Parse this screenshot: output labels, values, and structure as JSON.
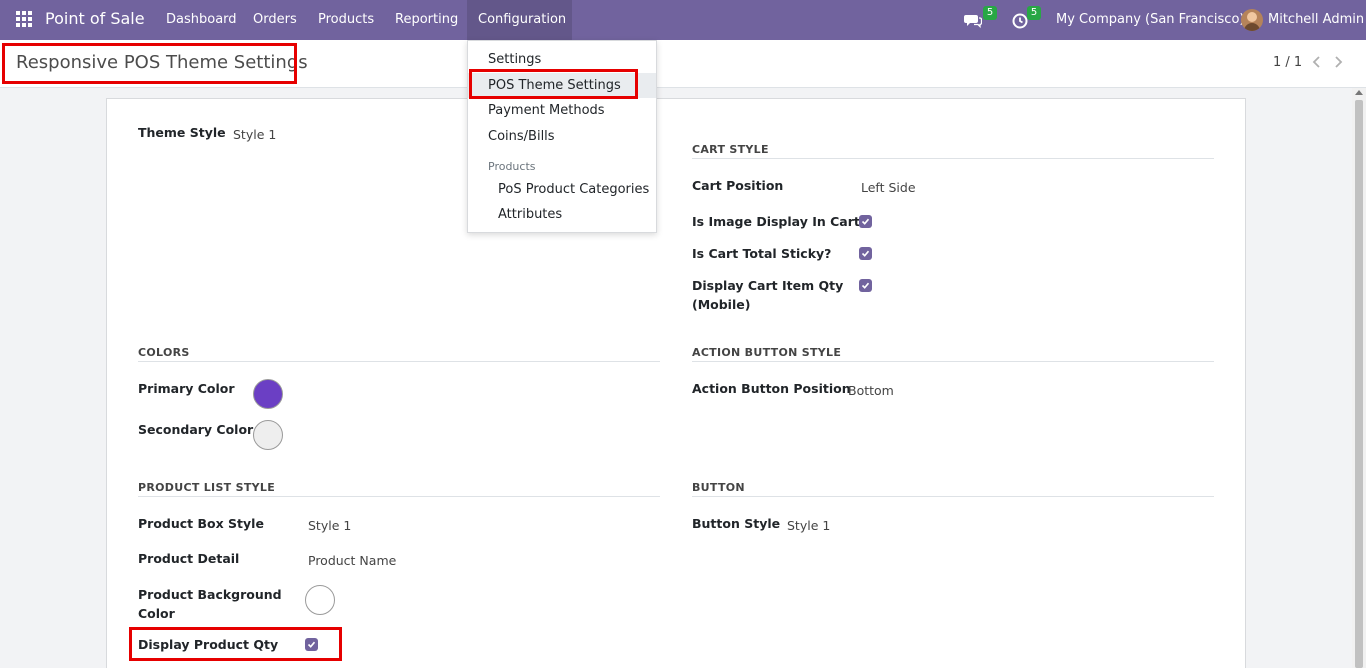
{
  "navbar": {
    "app_name": "Point of Sale",
    "menu": [
      "Dashboard",
      "Orders",
      "Products",
      "Reporting",
      "Configuration"
    ],
    "messages_count": "5",
    "activities_count": "5",
    "company": "My Company (San Francisco)",
    "user": "Mitchell Admin",
    "icons": [
      "apps-grid-icon",
      "chat-icon",
      "clock-icon",
      "avatar"
    ],
    "color": "#71639e"
  },
  "dropdown": {
    "items": [
      "Settings",
      "POS Theme Settings",
      "Payment Methods",
      "Coins/Bills"
    ],
    "products_header": "Products",
    "product_items": [
      "PoS Product Categories",
      "Attributes"
    ]
  },
  "control_panel": {
    "title": "Responsive POS Theme Settings",
    "pager": "1 / 1"
  },
  "form": {
    "theme_style": {
      "label": "Theme Style",
      "value": "Style 1"
    },
    "cart_style": {
      "section": "CART STYLE",
      "cart_position": {
        "label": "Cart Position",
        "value": "Left Side"
      },
      "image_display": {
        "label": "Is Image Display In Cart?",
        "checked": true
      },
      "total_sticky": {
        "label": "Is Cart Total Sticky?",
        "checked": true
      },
      "item_qty_line1": "Display Cart Item Qty",
      "item_qty_line2": "(Mobile)",
      "item_qty_checked": true
    },
    "colors": {
      "section": "COLORS",
      "primary_label": "Primary Color",
      "primary_value": "#6b3fc4",
      "secondary_label": "Secondary Color",
      "secondary_value": "#eeeeee"
    },
    "action_button_style": {
      "section": "ACTION BUTTON STYLE",
      "position_label": "Action Button Position",
      "position_value": "Bottom"
    },
    "product_list_style": {
      "section": "PRODUCT LIST STYLE",
      "box_style": {
        "label": "Product Box Style",
        "value": "Style 1"
      },
      "detail": {
        "label": "Product Detail",
        "value": "Product Name"
      },
      "bg_line1": "Product Background",
      "bg_line2": "Color",
      "bg_value": "#ffffff",
      "display_qty": {
        "label": "Display Product Qty",
        "checked": true
      }
    },
    "button": {
      "section": "BUTTON",
      "style_label": "Button Style",
      "style_value": "Style 1"
    }
  }
}
